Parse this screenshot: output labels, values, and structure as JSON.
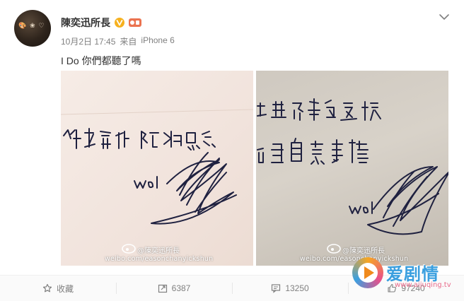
{
  "post": {
    "author": "陳奕迅所長",
    "avatar_doodle": "🎨 ❀ ♡",
    "date": "10月2日 17:45",
    "from_label": "来自",
    "device": "iPhone 6",
    "text": "I Do 你們都聽了嗎"
  },
  "photos": {
    "left": {
      "watermark_name": "@陳奕迅所長",
      "watermark_url": "weibo.com/easonchanyickshun"
    },
    "right": {
      "watermark_name": "@陳奕迅所長",
      "watermark_url": "weibo.com/easonchanyickshun"
    }
  },
  "actions": {
    "favorite_label": "收藏",
    "repost_count": "6387",
    "comment_count": "13250",
    "like_count": "97240"
  },
  "watermark_brand": {
    "title": "爱剧情",
    "url": "www.aijuqing.tv"
  },
  "colors": {
    "vip_badge": "#f6b11e",
    "level_badge": "#eb7350",
    "ink": "#1f2140",
    "brand_blue": "#3a9fdf"
  }
}
